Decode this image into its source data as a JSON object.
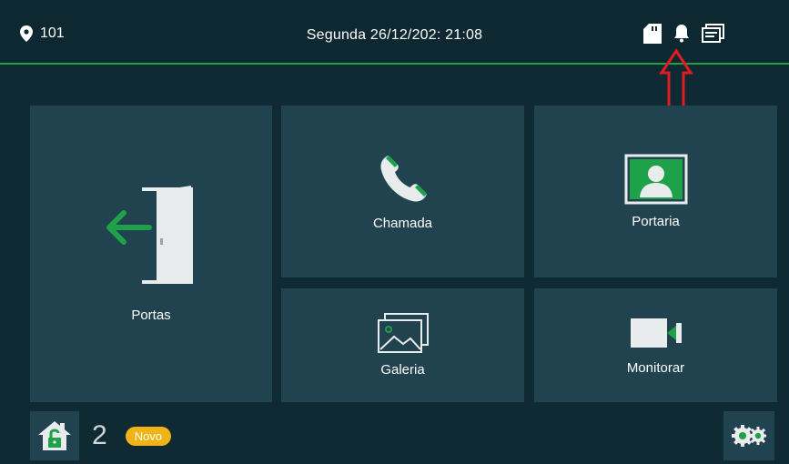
{
  "header": {
    "room": "101",
    "datetime": "Segunda 26/12/202:  21:08"
  },
  "tiles": {
    "portas": "Portas",
    "chamada": "Chamada",
    "portaria": "Portaria",
    "galeria": "Galeria",
    "monitorar": "Monitorar"
  },
  "footer": {
    "count": "2",
    "badge": "Novo"
  },
  "icons": {
    "room": "location-pin-icon",
    "status": [
      "sd-card-icon",
      "bell-icon",
      "message-icon"
    ],
    "home": "home-unlock-icon",
    "settings": "gears-icon"
  },
  "colors": {
    "background": "#0f2a33",
    "tile": "#21424f",
    "accent_green": "#1fa14a",
    "badge": "#f0b416",
    "annotation": "#e31b23"
  }
}
